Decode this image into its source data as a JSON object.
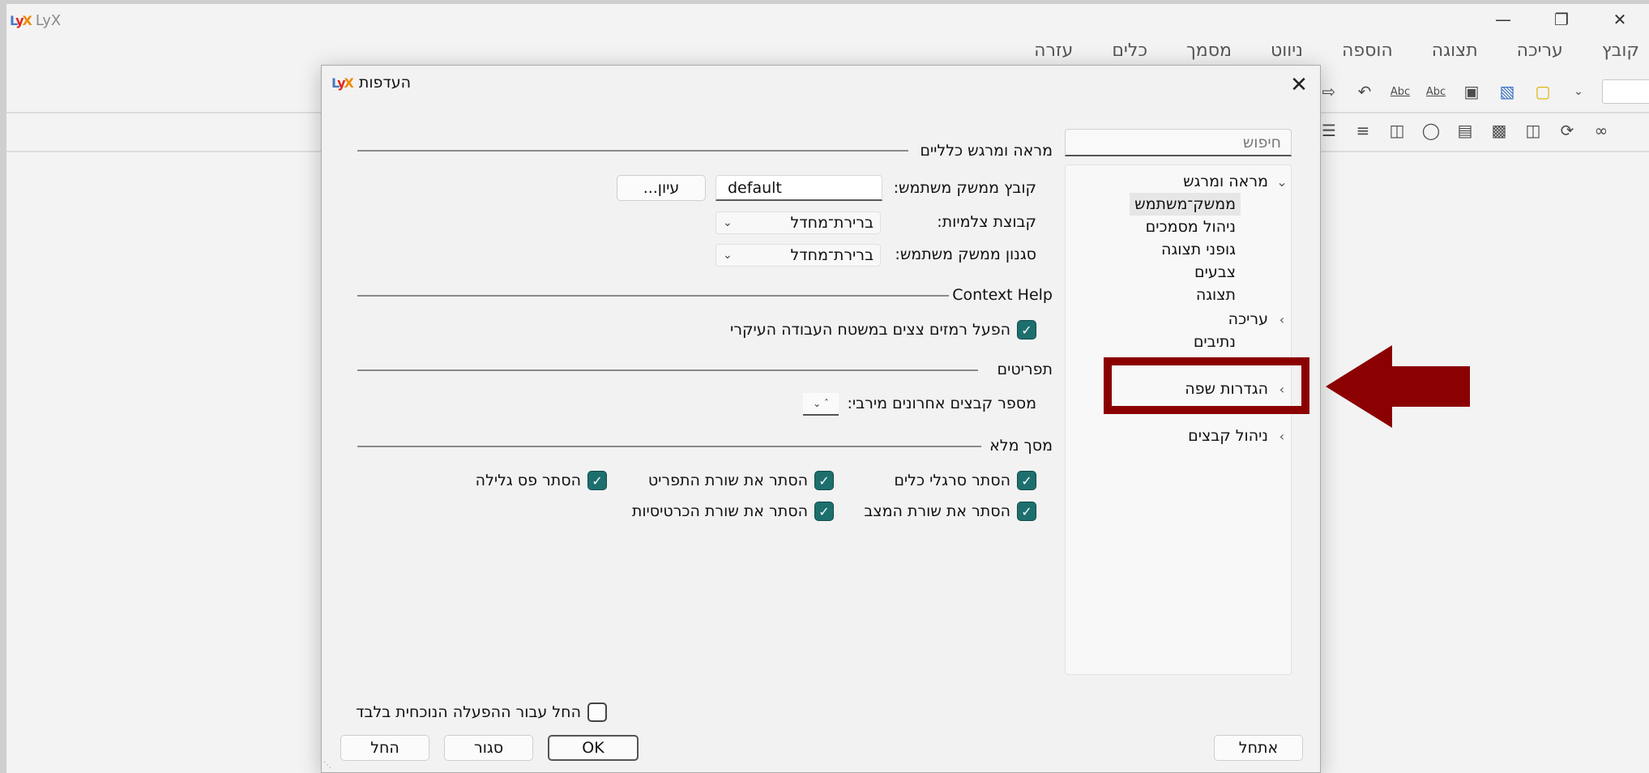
{
  "app": {
    "title": "LyX",
    "logo_text": "LyX"
  },
  "window_controls": {
    "minimize_icon": "minimize-icon",
    "maximize_icon": "restore-icon",
    "close_icon": "close-icon"
  },
  "menubar": {
    "items": [
      "קובץ",
      "עריכה",
      "תצוגה",
      "הוספה",
      "ניווט",
      "מסמך",
      "כלים",
      "עזרה"
    ]
  },
  "toolbar": {
    "row1_icons": [
      "redo-icon",
      "undo-icon",
      "spellcheck-icon",
      "spellcheck-continuous-icon",
      "save-icon",
      "open-icon",
      "new-document-icon",
      "dropdown-icon"
    ],
    "row2_icons": [
      "numbered-list-icon",
      "align-icon",
      "update-icon",
      "view-icon",
      "document-icon",
      "document-update-icon",
      "preview-icon",
      "refresh-icon",
      "glasses-icon"
    ]
  },
  "dialog": {
    "title": "העדפות",
    "close_icon": "close-icon",
    "search_placeholder": "חיפוש",
    "tree": {
      "look_and_feel": "מראה ומרגש",
      "user_interface": "ממשק־משתמש",
      "document_handling": "ניהול מסמכים",
      "screen_fonts": "גופני תצוגה",
      "colors": "צבעים",
      "display": "תצוגה",
      "editing": "עריכה",
      "paths": "נתיבים",
      "language_settings": "הגדרות שפה",
      "file_handling": "ניהול קבצים"
    },
    "general_section": {
      "heading": "מראה ומרגש כלליים",
      "ui_file_label": "קובץ ממשק משתמש:",
      "ui_file_value": "default",
      "browse_button": "עיון...",
      "icon_set_label": "קבוצת צלמיות:",
      "icon_set_value": "ברירת־מחדל",
      "ui_style_label": "סגנון ממשק משתמש:",
      "ui_style_value": "ברירת־מחדל"
    },
    "context_help_section": {
      "heading": "Context Help",
      "tooltips_label": "הפעל רמזים צצים במשטח העבודה העיקרי",
      "tooltips_checked": true
    },
    "menus_section": {
      "heading": "תפריטים",
      "recent_files_label": "מספר קבצים אחרונים מירבי:"
    },
    "fullscreen_section": {
      "heading": "מסך מלא",
      "hide_toolbars": "הסתר סרגלי כלים",
      "hide_menubar": "הסתר את שורת התפריט",
      "hide_scrollbar": "הסתר פס גלילה",
      "hide_statusbar": "הסתר את שורת המצב",
      "hide_tabbar": "הסתר את שורת הכרטיסיות"
    },
    "apply_current_session": "החל עבור ההפעלה הנוכחית בלבד",
    "buttons": {
      "restore": "אתחל",
      "ok": "OK",
      "close": "סגור",
      "apply": "החל"
    }
  },
  "annotation": {
    "highlight_color": "#8b0000"
  }
}
